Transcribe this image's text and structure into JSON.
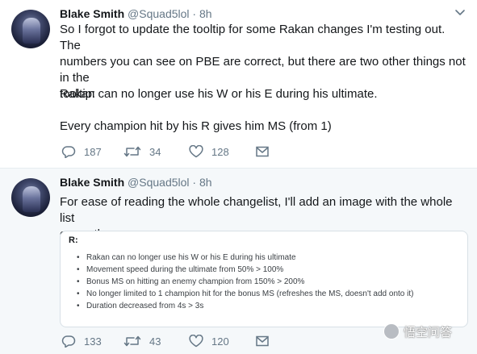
{
  "tweets": [
    {
      "author_name": "Blake Smith",
      "handle": "@Squad5lol",
      "separator": "·",
      "time": "8h",
      "text_lines": [
        "So I forgot to update the tooltip for some Rakan changes I'm testing out. The",
        "numbers you can see on PBE are correct, but there are two other things not in the",
        "tooltip:"
      ],
      "paragraph_2": "Rakan can no longer use his W or his E during his ultimate.",
      "paragraph_3": "Every champion hit by his R gives him MS (from 1)",
      "actions": {
        "replies": "187",
        "retweets": "34",
        "likes": "128"
      }
    },
    {
      "author_name": "Blake Smith",
      "handle": "@Squad5lol",
      "separator": "·",
      "time": "8h",
      "text_lines": [
        "For ease of reading the whole changelist, I'll add an image with the whole list",
        "currently."
      ],
      "card": {
        "title": "R:",
        "items": [
          "Rakan can no longer use his W or his E during his ultimate",
          "Movement speed during the ultimate from 50% > 100%",
          "Bonus MS on hitting an enemy champion from 150% > 200%",
          "No longer limited to 1 champion hit for the bonus MS (refreshes the MS, doesn't add onto it)",
          "Duration decreased from 4s > 3s"
        ]
      },
      "actions": {
        "replies": "133",
        "retweets": "43",
        "likes": "120"
      }
    }
  ],
  "watermark": {
    "text": "悟空问答"
  },
  "icons": {
    "reply": "reply-icon",
    "retweet": "retweet-icon",
    "like": "heart-icon",
    "message": "envelope-icon",
    "caret": "chevron-down-icon"
  },
  "colors": {
    "text": "#14171a",
    "secondary": "#657786",
    "divider": "#e6ecf0",
    "background_alt": "#f5f8fa"
  }
}
